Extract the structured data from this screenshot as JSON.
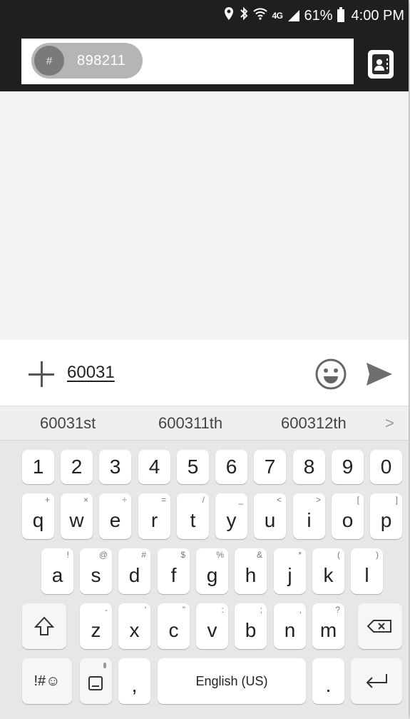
{
  "status_bar": {
    "battery_percent": "61%",
    "time": "4:00 PM",
    "network": "4G LTE",
    "icons": [
      "location-icon",
      "bluetooth-icon",
      "wifi-icon",
      "lte-icon",
      "signal-icon",
      "battery-icon"
    ]
  },
  "header": {
    "recipient_chip": {
      "avatar_symbol": "#",
      "number": "898211"
    },
    "contacts_button_icon": "contact-card-icon"
  },
  "compose": {
    "text": "60031",
    "add_icon": "plus-icon",
    "emoji_icon": "emoji-icon",
    "send_icon": "send-icon"
  },
  "suggestions": [
    "60031st",
    "600311th",
    "600312th"
  ],
  "suggestion_more": ">",
  "keyboard": {
    "number_row": [
      "1",
      "2",
      "3",
      "4",
      "5",
      "6",
      "7",
      "8",
      "9",
      "0"
    ],
    "row1": [
      {
        "key": "q",
        "hint": "+"
      },
      {
        "key": "w",
        "hint": "×"
      },
      {
        "key": "e",
        "hint": "÷"
      },
      {
        "key": "r",
        "hint": "="
      },
      {
        "key": "t",
        "hint": "/"
      },
      {
        "key": "y",
        "hint": "_"
      },
      {
        "key": "u",
        "hint": "<"
      },
      {
        "key": "i",
        "hint": ">"
      },
      {
        "key": "o",
        "hint": "["
      },
      {
        "key": "p",
        "hint": "]"
      }
    ],
    "row2": [
      {
        "key": "a",
        "hint": "!"
      },
      {
        "key": "s",
        "hint": "@"
      },
      {
        "key": "d",
        "hint": "#"
      },
      {
        "key": "f",
        "hint": "$"
      },
      {
        "key": "g",
        "hint": "%"
      },
      {
        "key": "h",
        "hint": "&"
      },
      {
        "key": "j",
        "hint": "*"
      },
      {
        "key": "k",
        "hint": "("
      },
      {
        "key": "l",
        "hint": ")"
      }
    ],
    "row3": [
      {
        "key": "z",
        "hint": "-"
      },
      {
        "key": "x",
        "hint": "'"
      },
      {
        "key": "c",
        "hint": "\""
      },
      {
        "key": "v",
        "hint": ":"
      },
      {
        "key": "b",
        "hint": ";"
      },
      {
        "key": "n",
        "hint": ","
      },
      {
        "key": "m",
        "hint": "?"
      }
    ],
    "symbols_label": "!#☺",
    "comma": ",",
    "space_label": "English (US)",
    "period": ".",
    "shift_icon": "shift-icon",
    "backspace_icon": "backspace-icon",
    "enter_icon": "enter-icon",
    "keyboard_settings_icon": "keyboard-mic-icon"
  }
}
